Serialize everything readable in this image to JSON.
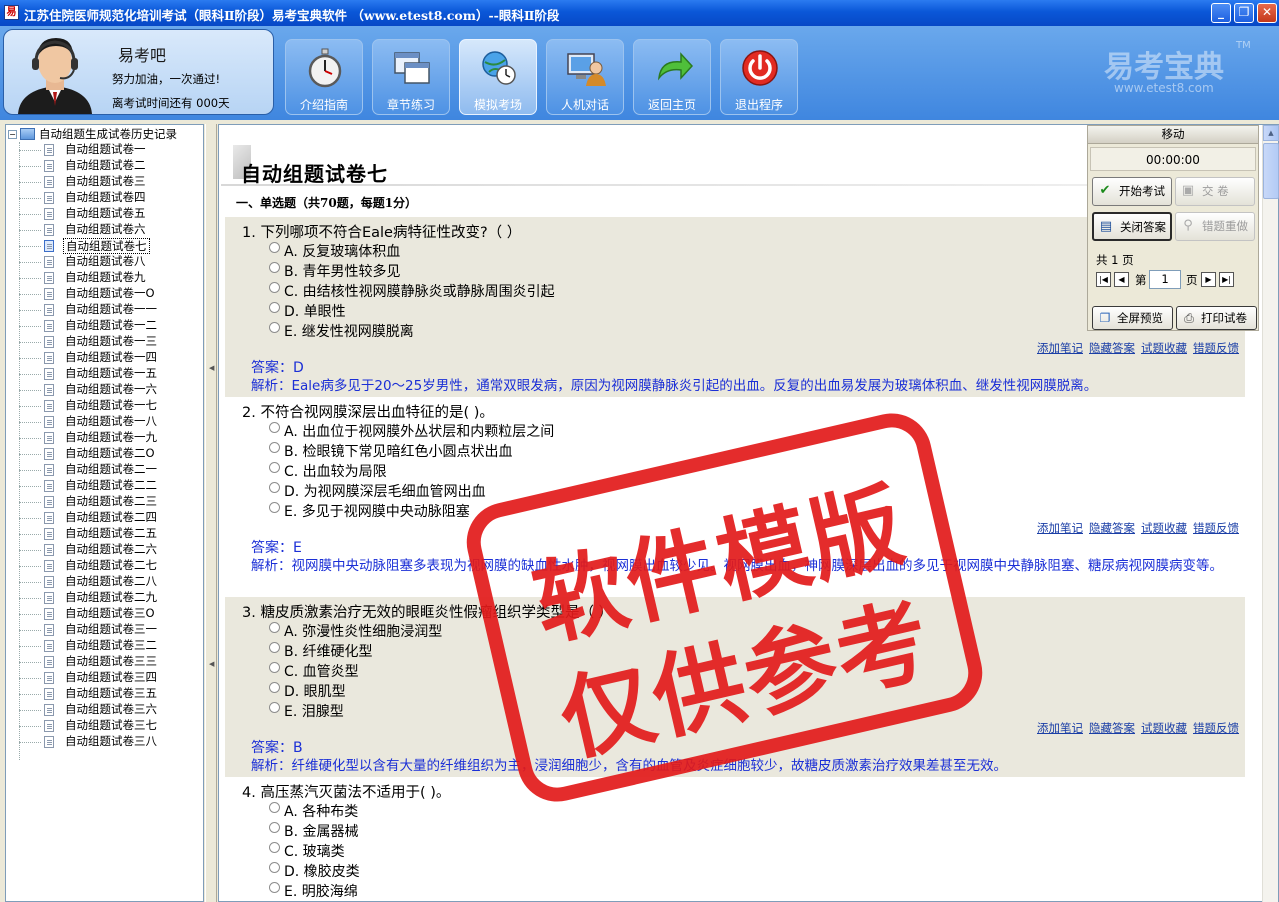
{
  "window": {
    "title": "江苏住院医师规范化培训考试（眼科Ⅱ阶段）易考宝典软件  （www.etest8.com）--眼科Ⅱ阶段",
    "app_icon": "易",
    "minimize": "_",
    "maximize": "❐",
    "close": "✕"
  },
  "profile": {
    "name": "易考吧",
    "slogan": "努力加油，一次通过!",
    "days_left": "离考试时间还有 000天"
  },
  "toolbar": [
    {
      "label": "介绍指南",
      "icon": "stopwatch-icon"
    },
    {
      "label": "章节练习",
      "icon": "windows-icon"
    },
    {
      "label": "模拟考场",
      "icon": "globe-clock-icon"
    },
    {
      "label": "人机对话",
      "icon": "computer-person-icon"
    },
    {
      "label": "返回主页",
      "icon": "return-arrow-icon"
    },
    {
      "label": "退出程序",
      "icon": "power-icon"
    }
  ],
  "brand": {
    "name": "易考宝典",
    "tm": "TM",
    "url": "www.etest8.com"
  },
  "tree": {
    "root": "自动组题生成试卷历史记录",
    "items": [
      "自动组题试卷一",
      "自动组题试卷二",
      "自动组题试卷三",
      "自动组题试卷四",
      "自动组题试卷五",
      "自动组题试卷六",
      "自动组题试卷七",
      "自动组题试卷八",
      "自动组题试卷九",
      "自动组题试卷一O",
      "自动组题试卷一一",
      "自动组题试卷一二",
      "自动组题试卷一三",
      "自动组题试卷一四",
      "自动组题试卷一五",
      "自动组题试卷一六",
      "自动组题试卷一七",
      "自动组题试卷一八",
      "自动组题试卷一九",
      "自动组题试卷二O",
      "自动组题试卷二一",
      "自动组题试卷二二",
      "自动组题试卷二三",
      "自动组题试卷二四",
      "自动组题试卷二五",
      "自动组题试卷二六",
      "自动组题试卷二七",
      "自动组题试卷二八",
      "自动组题试卷二九",
      "自动组题试卷三O",
      "自动组题试卷三一",
      "自动组题试卷三二",
      "自动组题试卷三三",
      "自动组题试卷三四",
      "自动组题试卷三五",
      "自动组题试卷三六",
      "自动组题试卷三七",
      "自动组题试卷三八"
    ],
    "selected_index": 6
  },
  "paper": {
    "title": "自动组题试卷七",
    "section": "一、单选题（共70题，每题1分）"
  },
  "link_labels": {
    "note": "添加笔记",
    "hide": "隐藏答案",
    "fav": "试题收藏",
    "feedback": "错题反馈"
  },
  "questions": [
    {
      "stem": "1. 下列哪项不符合Eale病特征性改变?（ ）",
      "options": [
        "A. 反复玻璃体积血",
        "B. 青年男性较多见",
        "C. 由结核性视网膜静脉炎或静脉周围炎引起",
        "D. 单眼性",
        "E. 继发性视网膜脱离"
      ],
      "answer": "答案：D",
      "analysis": "解析：Eale病多见于20～25岁男性，通常双眼发病，原因为视网膜静脉炎引起的出血。反复的出血易发展为玻璃体积血、继发性视网膜脱离。"
    },
    {
      "stem": "2. 不符合视网膜深层出血特征的是(  )。",
      "options": [
        "A. 出血位于视网膜外丛状层和内颗粒层之间",
        "B. 检眼镜下常见暗红色小圆点状出血",
        "C. 出血较为局限",
        "D. 为视网膜深层毛细血管网出血",
        "E. 多见于视网膜中央动脉阻塞"
      ],
      "answer": "答案：E",
      "analysis": "解析：视网膜中央动脉阻塞多表现为视网膜的缺血性水肿，视网膜出血较少见。视网膜出血，神网膜深层出血的多见于视网膜中央静脉阻塞、糖尿病视网膜病变等。"
    },
    {
      "stem": "3. 糖皮质激素治疗无效的眼眶炎性假瘤组织学类型是（  ）",
      "options": [
        "A. 弥漫性炎性细胞浸润型",
        "B. 纤维硬化型",
        "C. 血管炎型",
        "D. 眼肌型",
        "E. 泪腺型"
      ],
      "answer": "答案：B",
      "analysis": "解析：纤维硬化型以含有大量的纤维组织为主，浸润细胞少，含有的血管及炎症细胞较少，故糖皮质激素治疗效果差甚至无效。"
    },
    {
      "stem": "4. 高压蒸汽灭菌法不适用于(  )。",
      "options": [
        "A. 各种布类",
        "B. 金属器械",
        "C. 玻璃类",
        "D. 橡胶皮类",
        "E. 明胶海绵"
      ]
    }
  ],
  "panel": {
    "move": "移动",
    "timer": "00:00:00",
    "start_exam": "开始考试",
    "submit": "交    卷",
    "close_answer": "关闭答案",
    "redo_wrong": "错题重做",
    "total_pages": "共 1 页",
    "page_prefix": "第",
    "page_value": "1",
    "page_suffix": "页",
    "fullscreen": "全屏预览",
    "print": "打印试卷"
  },
  "watermark": {
    "line1": "软件模版",
    "line2": "仅供参考"
  }
}
